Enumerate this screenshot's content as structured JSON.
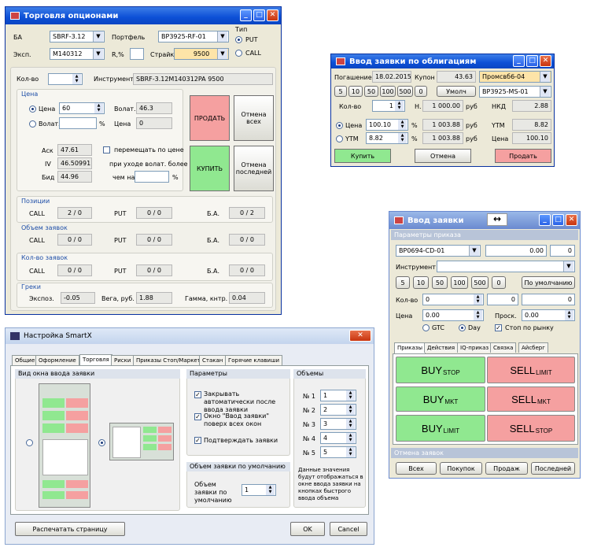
{
  "options": {
    "title": "Торговля опционами",
    "ba_label": "БА",
    "ba_value": "SBRF-3.12",
    "portfolio_label": "Портфель",
    "portfolio_value": "BP3925-RF-01",
    "type_label": "Тип",
    "put": "PUT",
    "call": "CALL",
    "exp_label": "Эксп.",
    "exp_value": "M140312",
    "r_label": "R,%",
    "strike_label": "Страйк",
    "strike_value": "9500",
    "qty_label": "Кол-во",
    "instrument_label": "Инструмент",
    "instrument_value": "SBRF-3.12M140312PA 9500",
    "price_section": "Цена",
    "price_label": "Цена",
    "price_value": "60",
    "volat_label": "Волат.",
    "volat_value": "46.3",
    "pct": "%",
    "price2_label": "Цена",
    "price2_value": "0",
    "sell": "ПРОДАТЬ",
    "cancel_all": "Отмена всех",
    "buy": "КУПИТЬ",
    "cancel_last": "Отмена последней",
    "ask_label": "Аск",
    "ask_value": "47.61",
    "iv_label": "IV",
    "iv_value": "46.50991",
    "bid_label": "Бид",
    "bid_value": "44.96",
    "move_label": "перемещать по цене",
    "when_label": "при уходе волат. более",
    "than_label": "чем на",
    "positions": "Позиции",
    "orders_volume": "Объем заявок",
    "orders_count": "Кол-во заявок",
    "call_l": "CALL",
    "put_l": "PUT",
    "ba_l": "Б.А.",
    "pos_call": "2 / 0",
    "pos_put": "0 / 0",
    "pos_ba": "0 / 2",
    "vol_call": "0 / 0",
    "vol_put": "0 / 0",
    "vol_ba": "0 / 0",
    "cnt_call": "0 / 0",
    "cnt_put": "0 / 0",
    "cnt_ba": "0 / 0",
    "greeks": "Греки",
    "expos_label": "Экспоз.",
    "expos_value": "-0.05",
    "vega_label": "Вега, руб.",
    "vega_value": "1.88",
    "gamma_label": "Гамма, кнтр.",
    "gamma_value": "0.04"
  },
  "bonds": {
    "title": "Ввод заявки по облигациям",
    "maturity_label": "Погашение",
    "maturity_value": "18.02.2015",
    "coupon_label": "Купон",
    "coupon_value": "43.63",
    "issuer_value": "Промсвб6-04",
    "qty_buttons": [
      "5",
      "10",
      "50",
      "100",
      "500",
      "0"
    ],
    "default_btn": "Умолч",
    "account_value": "BP3925-MS-01",
    "qty_label": "Кол-во",
    "qty_value": "1",
    "n_label": "Н.",
    "n_value": "1 000.00",
    "rub": "руб",
    "nkd_label": "НКД",
    "nkd_value": "2.88",
    "price_label": "Цена",
    "price_pct": "100.10",
    "price_rub": "1 003.88",
    "ytm_label": "YTM",
    "ytm_value": "8.82",
    "ytm_radio": "YTM",
    "ytm_pct": "8.82",
    "ytm_rub": "1 003.88",
    "price2_label": "Цена",
    "price2_value": "100.10",
    "buy": "Купить",
    "cancel": "Отмена",
    "sell": "Продать",
    "pct": "%"
  },
  "smartx": {
    "title": "Настройка SmartX",
    "tabs": [
      "Общие",
      "Оформление",
      "Торговля",
      "Риски",
      "Приказы Стоп/Маркет",
      "Стакан",
      "Горячие клавиши"
    ],
    "view_section": "Вид окна ввода заявки",
    "params_section": "Параметры",
    "opt1": "Закрывать автоматически после ввода заявки",
    "opt2": "Окно \"Ввод заявки\" поверх всех окон",
    "opt3": "Подтверждать заявки",
    "default_vol_section": "Объем заявки по умолчанию",
    "default_vol_label": "Объем заявки по умолчанию",
    "default_vol_value": "1",
    "volumes_section": "Объемы",
    "volumes": [
      {
        "label": "№ 1",
        "value": "1"
      },
      {
        "label": "№ 2",
        "value": "2"
      },
      {
        "label": "№ 3",
        "value": "3"
      },
      {
        "label": "№ 4",
        "value": "4"
      },
      {
        "label": "№ 5",
        "value": "5"
      }
    ],
    "volumes_note": "Данные значения будут отображаться в окне ввода заявки на кнопках быстрого ввода объема",
    "print_btn": "Распечатать страницу",
    "ok": "OK",
    "cancel": "Cancel"
  },
  "order": {
    "title": "Ввод заявки",
    "params_section": "Параметры приказа",
    "account_value": "BP0694-CD-01",
    "price_top": "0.00",
    "qty_top": "0",
    "instrument_label": "Инструмент",
    "qty_buttons": [
      "5",
      "10",
      "50",
      "100",
      "500",
      "0"
    ],
    "default_btn": "По умолчанию",
    "qty_label": "Кол-во",
    "qty_value": "0",
    "qty2": "0",
    "qty3": "0",
    "price_label": "Цена",
    "price_value": "0.00",
    "prosk_label": "Проск.",
    "prosk_value": "0.00",
    "gtc": "GTC",
    "day": "Day",
    "stop_market": "Стоп по рынку",
    "tabs": [
      "Приказы",
      "Действия",
      "IQ-приказ",
      "Связка",
      "Айсберг"
    ],
    "buy_stop": "BUY",
    "buy_stop_sub": "STOP",
    "sell_limit": "SELL",
    "sell_limit_sub": "LIMIT",
    "buy_mkt": "BUY",
    "buy_mkt_sub": "MKT",
    "sell_mkt": "SELL",
    "sell_mkt_sub": "MKT",
    "buy_limit": "BUY",
    "buy_limit_sub": "LIMIT",
    "sell_stop": "SELL",
    "sell_stop_sub": "STOP",
    "cancel_section": "Отмена заявок",
    "cancel_buttons": [
      "Всех",
      "Покупок",
      "Продаж",
      "Последней"
    ]
  },
  "colors": {
    "sell_red": "#f5a0a0",
    "buy_green": "#90e890",
    "titlebar_blue": "#0c4fd6",
    "section_blue": "#1f4fa8"
  }
}
